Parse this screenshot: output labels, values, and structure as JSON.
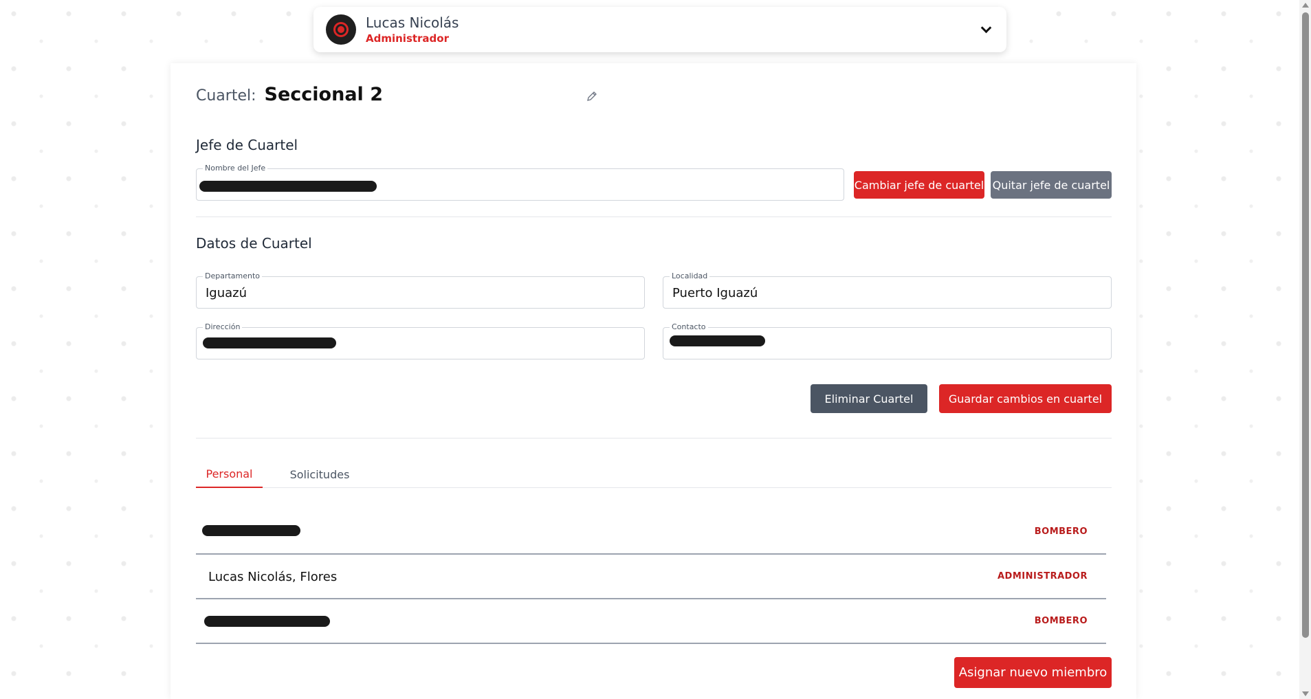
{
  "user": {
    "name": "Lucas Nicolás",
    "role": "Administrador"
  },
  "cuartel": {
    "label": "Cuartel:",
    "name": "Seccional 2"
  },
  "jefe": {
    "section_title": "Jefe de Cuartel",
    "field_label": "Nombre del Jefe",
    "change_button": "Cambiar jefe de cuartel",
    "remove_button": "Quitar jefe de cuartel"
  },
  "datos": {
    "section_title": "Datos de Cuartel",
    "departamento_label": "Departamento",
    "departamento_value": "Iguazú",
    "localidad_label": "Localidad",
    "localidad_value": "Puerto Iguazú",
    "direccion_label": "Dirección",
    "contacto_label": "Contacto",
    "delete_button": "Eliminar Cuartel",
    "save_button": "Guardar cambios en cuartel"
  },
  "tabs": [
    {
      "label": "Personal",
      "active": true
    },
    {
      "label": "Solicitudes",
      "active": false
    }
  ],
  "members": [
    {
      "name": "",
      "role": "BOMBERO"
    },
    {
      "name": "Lucas Nicolás, Flores",
      "role": "ADMINISTRADOR"
    },
    {
      "name": "",
      "role": "BOMBERO"
    }
  ],
  "assign_button": "Asignar nuevo miembro",
  "colors": {
    "accent": "#dc2626",
    "gray_button": "#6b7280",
    "slate_button": "#4b5563"
  },
  "icons": {
    "edit": "pencil-icon",
    "expand": "chevron-down-icon",
    "avatar": "firefighter-badge-icon"
  }
}
